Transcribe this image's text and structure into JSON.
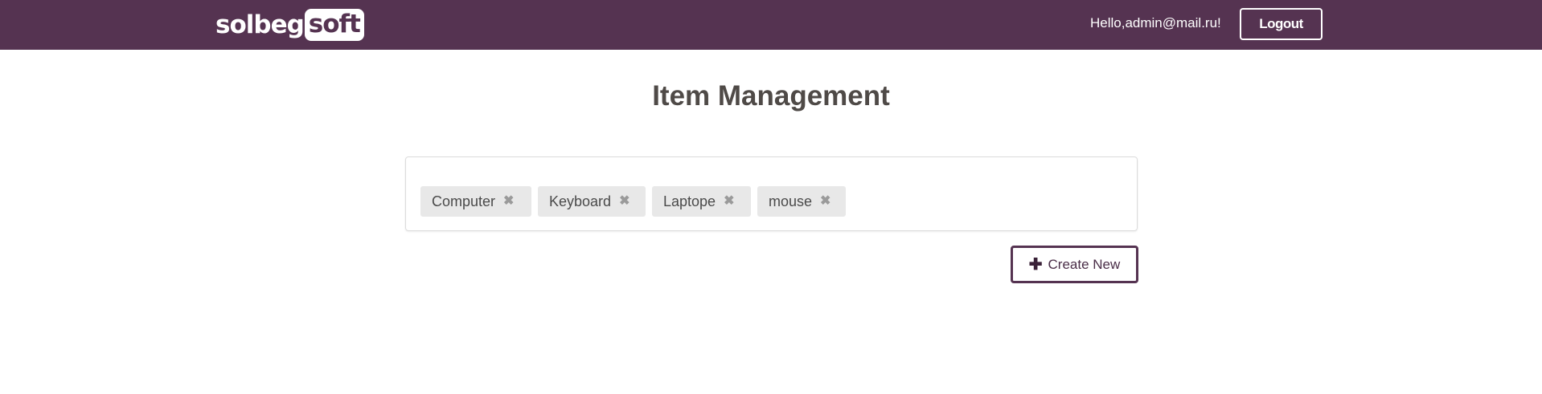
{
  "header": {
    "logo_part1": "solbeg",
    "logo_part2": "soft",
    "greeting": "Hello,admin@mail.ru!",
    "logout_label": "Logout"
  },
  "colors": {
    "brand": "#553351",
    "tag_bg": "#e8e8e8",
    "title": "#4f4a47"
  },
  "main": {
    "title": "Item Management",
    "items": [
      {
        "label": "Computer",
        "remove_icon": "✖"
      },
      {
        "label": "Keyboard",
        "remove_icon": "✖"
      },
      {
        "label": "Laptope",
        "remove_icon": "✖"
      },
      {
        "label": "mouse",
        "remove_icon": "✖"
      }
    ],
    "create_icon": "✚",
    "create_label": "Create New"
  }
}
